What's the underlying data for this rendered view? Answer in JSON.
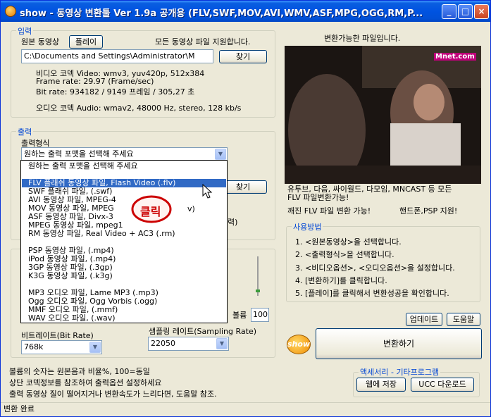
{
  "window": {
    "title": "show - 동영상 변환툴 Ver 1.9a 공개용 (FLV,SWF,MOV,AVI,WMV,ASF,MPG,OGG,RM,P...",
    "minimize": "_",
    "maximize": "□",
    "close": "×"
  },
  "input": {
    "legend": "입력",
    "source_label": "원본 동영상",
    "play_button": "플레이",
    "support_text": "모든 동영상 파일 지원합니다.",
    "path_value": "C:\\Documents and Settings\\Administrator\\M",
    "browse_button": "찾기",
    "video_codec": "비디오 코덱 Video: wmv3, yuv420p, 512x384",
    "frame_rate": "Frame rate: 29.97 (Frame/sec)",
    "bit_rate": "Bit rate: 934182 / 9149 프레임 / 305,27 초",
    "audio_codec": "오디오 코덱 Audio: wmav2, 48000 Hz, stereo, 128 kb/s"
  },
  "output": {
    "legend": "출력",
    "format_label": "출력형식",
    "format_selected": "원하는 출력 포맷을 선택해 주세요",
    "browse_button": "찾기",
    "partial_right": "력)"
  },
  "dropdown": {
    "items": [
      "원하는 출력 포맷을 선택해 주세요",
      "FLV 플래쉬 동영상 파일, Flash Video (.flv)",
      "SWF 플래쉬 파일, (.swf)",
      "AVI 동영상 파일, MPEG-4",
      "MOV 동영상 파일, MPEG",
      "ASF 동영상 파일, Divx-3",
      "MPEG 동영상 파일, mpeg1",
      "RM 동영상 파일, Real Video + AC3 (.rm)",
      "PSP 동영상 파일, (.mp4)",
      "iPod 동영상 파일, (.mp4)",
      "3GP 동영상 파일, (.3gp)",
      "K3G 동영상 파일, (.k3g)",
      "MP3 오디오 파일, Lame MP3 (.mp3)",
      "Ogg 오디오 파일, Ogg Vorbis (.ogg)",
      "MMF 오디오 파일, (.mmf)",
      "WAV 오디오 파일, (.wav)"
    ],
    "partial_suffix": "v)",
    "callout": "클릭"
  },
  "settings": {
    "volume_label": "볼륨",
    "volume_value": "100",
    "bitrate_label": "비트레이트(Bit Rate)",
    "bitrate_value": "768k",
    "sampling_label": "샘플링 레이트(Sampling Rate)",
    "sampling_value": "22050"
  },
  "notes": {
    "line1": "볼륨의 숫자는 원본음과 비율%, 100=동일",
    "line2": "상단 코덱정보를 참조하여 출력옵션 설정하세요",
    "line3": "출력 동영상 질이 떨어지거나 변환속도가 느리다면, 도움말 참조."
  },
  "preview": {
    "header": "변환가능한 파일입니다.",
    "watermark": "Mnet.com",
    "desc_line1": "유투브, 다음, 싸이월드, 다모임, MNCAST 등 모든",
    "desc_line2": "FLV 파일변환가능!",
    "desc_line3": "깨진 FLV 파일 변환 가능!",
    "desc_line4": "핸드폰,PSP 지원!"
  },
  "howto": {
    "legend": "사용방법",
    "steps": [
      "1. <원본동영상>을 선택합니다.",
      "2. <출력형식>을 선택합니다.",
      "3. <비디오옵션>, <오디오옵션>을 설정합니다.",
      "4. [변환하기]를 클릭합니다.",
      "5. [플레이]를 클릭해서 변환성공을 확인합니다."
    ]
  },
  "actions": {
    "update_button": "업데이트",
    "help_button": "도움말",
    "convert_button": "변환하기",
    "logo_text": "show",
    "accessory_legend": "액세서리 - 기타프로그램",
    "web_save_button": "웹에 저장",
    "ucc_button": "UCC 다운로드"
  },
  "status": {
    "text": "변환 완료"
  },
  "colors": {
    "titlebar": "#0053e1",
    "legend_text": "#0046d5",
    "selection": "#316ac5",
    "callout": "#cc0000"
  }
}
